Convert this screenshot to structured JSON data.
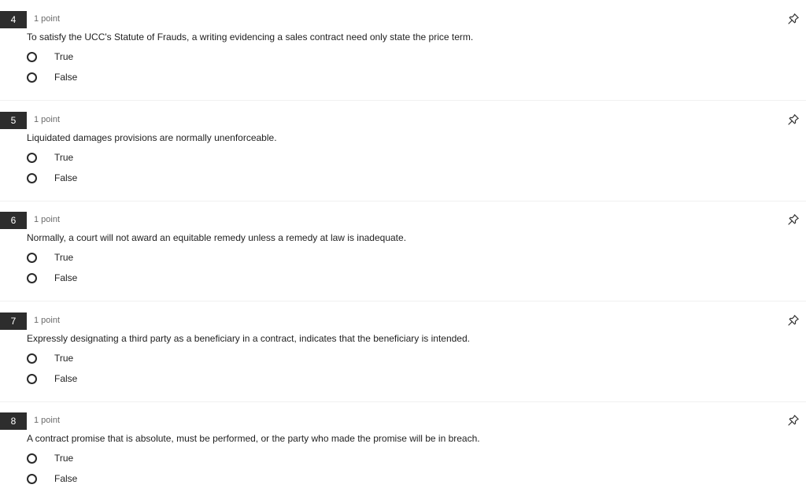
{
  "questions": [
    {
      "number": "4",
      "points": "1 point",
      "prompt": "To satisfy the UCC's Statute of Frauds, a writing evidencing a sales contract need only state the price term.",
      "options": [
        "True",
        "False"
      ]
    },
    {
      "number": "5",
      "points": "1 point",
      "prompt": "Liquidated damages provisions are normally unenforceable.",
      "options": [
        "True",
        "False"
      ]
    },
    {
      "number": "6",
      "points": "1 point",
      "prompt": "Normally, a court will not award an equitable remedy unless a remedy at law is inadequate.",
      "options": [
        "True",
        "False"
      ]
    },
    {
      "number": "7",
      "points": "1 point",
      "prompt": "Expressly designating a third party as a beneficiary in a contract, indicates that the beneficiary is intended.",
      "options": [
        "True",
        "False"
      ]
    },
    {
      "number": "8",
      "points": "1 point",
      "prompt": "A contract promise that is absolute, must be performed, or the party who made the promise will be in breach.",
      "options": [
        "True",
        "False"
      ]
    }
  ],
  "icons": {
    "pin": "pin-icon",
    "radio": "radio-unchecked-icon"
  },
  "colors": {
    "number_badge_bg": "#2d2d2d",
    "number_badge_fg": "#ffffff",
    "points_text": "#6b6b6b",
    "divider": "#f0f0f0"
  }
}
